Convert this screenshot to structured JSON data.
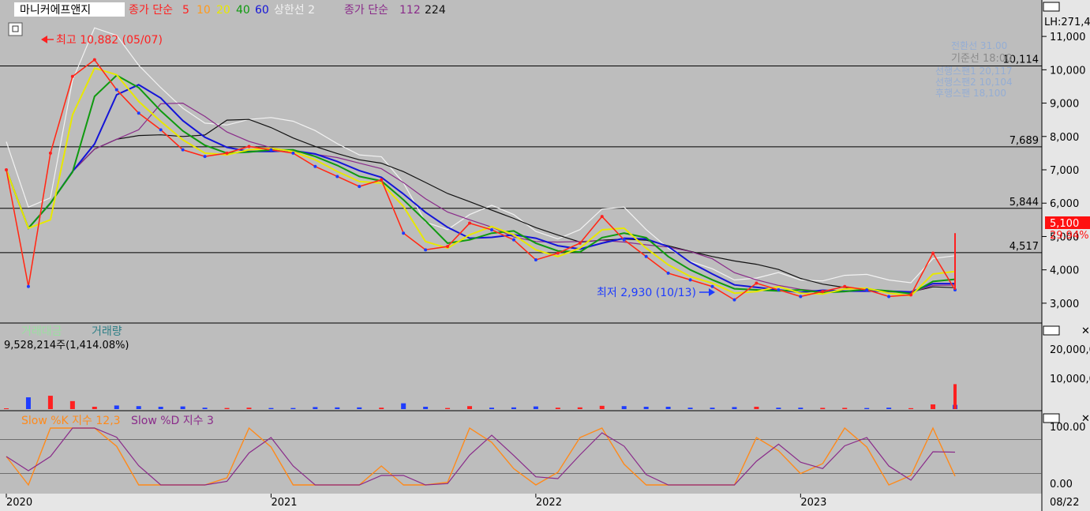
{
  "header": {
    "stock_name": "마니커에프앤지",
    "ma_short_label": "종가 단순",
    "ma_short_periods": [
      {
        "label": "5",
        "color": "#ff2020"
      },
      {
        "label": "10",
        "color": "#ff9a1a"
      },
      {
        "label": "20",
        "color": "#e8e800"
      },
      {
        "label": "40",
        "color": "#0f9a0f"
      },
      {
        "label": "60",
        "color": "#1414d8"
      }
    ],
    "upper_line_label": "상한선 2",
    "ma_long_label": "종가 단순",
    "ma_long_periods": [
      {
        "label": "112",
        "color": "#8a2b8a"
      },
      {
        "label": "224",
        "color": "#111111"
      }
    ]
  },
  "annotations": {
    "high_label": "최고 10,882 (05/07)",
    "low_label": "최저 2,930 (10/13)",
    "baseline_label": "기준선 18:00",
    "faded_labels": [
      "전환선 31.00",
      "선행스팬1 20,117",
      "선행스팬2 10,104",
      "후행스팬 18,100"
    ]
  },
  "price_axis": {
    "header": "LH:271,4",
    "ticks": [
      "11,000",
      "10,000",
      "9,000",
      "8,000",
      "7,000",
      "6,000",
      "5,000",
      "4,000",
      "3,000"
    ],
    "current_price": "5,100",
    "change_pct": "29.94%"
  },
  "volume_panel": {
    "legend": [
      "거래대금",
      "거래량"
    ],
    "readout": "9,528,214주(1,414.08%)",
    "ticks": [
      "20,000,0",
      "10,000,0"
    ]
  },
  "stochastic_panel": {
    "legend_k": "Slow %K 지수 12,3",
    "legend_d": "Slow %D 지수 3",
    "ticks": [
      "100.00",
      "0.00"
    ]
  },
  "time_axis": {
    "labels": [
      "2020",
      "2021",
      "2022",
      "2023"
    ],
    "right_label": "08/22"
  },
  "colors": {
    "up": "#ff2020",
    "down": "#1e3cff",
    "background": "#bdbdbd",
    "grid": "#000000",
    "envelope": "#f2f2f2"
  },
  "chart_data": {
    "type": "line",
    "title": "마니커에프앤지",
    "period": "2020-01 to 2023-08",
    "x": [
      "2020-01",
      "2020-02",
      "2020-03",
      "2020-04",
      "2020-05",
      "2020-06",
      "2020-07",
      "2020-08",
      "2020-09",
      "2020-10",
      "2020-11",
      "2020-12",
      "2021-01",
      "2021-02",
      "2021-03",
      "2021-04",
      "2021-05",
      "2021-06",
      "2021-07",
      "2021-08",
      "2021-09",
      "2021-10",
      "2021-11",
      "2021-12",
      "2022-01",
      "2022-02",
      "2022-03",
      "2022-04",
      "2022-05",
      "2022-06",
      "2022-07",
      "2022-08",
      "2022-09",
      "2022-10",
      "2022-11",
      "2022-12",
      "2023-01",
      "2023-02",
      "2023-03",
      "2023-04",
      "2023-05",
      "2023-06",
      "2023-07",
      "2023-08"
    ],
    "series": [
      {
        "name": "종가",
        "values": [
          7000,
          3500,
          7500,
          9800,
          10300,
          9400,
          8700,
          8200,
          7600,
          7400,
          7500,
          7700,
          7600,
          7500,
          7100,
          6800,
          6500,
          6700,
          5100,
          4600,
          4700,
          5400,
          5200,
          4900,
          4300,
          4500,
          4800,
          5600,
          4900,
          4400,
          3900,
          3700,
          3500,
          3100,
          3600,
          3400,
          3200,
          3350,
          3500,
          3400,
          3200,
          3250,
          4500,
          3400
        ]
      }
    ],
    "horizontal_levels": [
      10114,
      7689,
      5844,
      4517
    ],
    "high": {
      "value": 10882,
      "date": "05/07"
    },
    "low": {
      "value": 2930,
      "date": "10/13"
    },
    "last_close": 5100,
    "change_pct": 29.94,
    "price_ylim": [
      2500,
      11500
    ],
    "volume": {
      "last": 9528214,
      "ylim": [
        0,
        22000000
      ]
    },
    "stochastic": {
      "ylim": [
        0,
        100
      ],
      "levels": [
        80,
        20
      ]
    }
  }
}
